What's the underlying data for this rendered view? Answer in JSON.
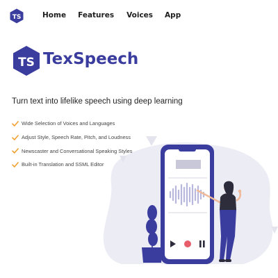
{
  "header": {
    "logo_initials": "TS",
    "nav": [
      {
        "label": "Home"
      },
      {
        "label": "Features"
      },
      {
        "label": "Voices"
      },
      {
        "label": "App"
      }
    ]
  },
  "hero": {
    "brand_initials": "TS",
    "brand_name": "TexSpeech",
    "tagline": "Turn text into lifelike speech using deep learning",
    "features": [
      "Wide Selection of Voices and Languages",
      "Adjust Style, Speech Rate, Pitch, and Loudness",
      "Newscaster and Conversational Speaking Styles",
      "Built-in Translation and SSML Editor"
    ]
  },
  "illustration": {
    "icons": [
      "play-icon",
      "record-icon",
      "pause-icon"
    ]
  },
  "colors": {
    "brand": "#3b3d9e",
    "accent_check": "#f0a030",
    "blob": "#ececf4",
    "record": "#e75d6a"
  }
}
